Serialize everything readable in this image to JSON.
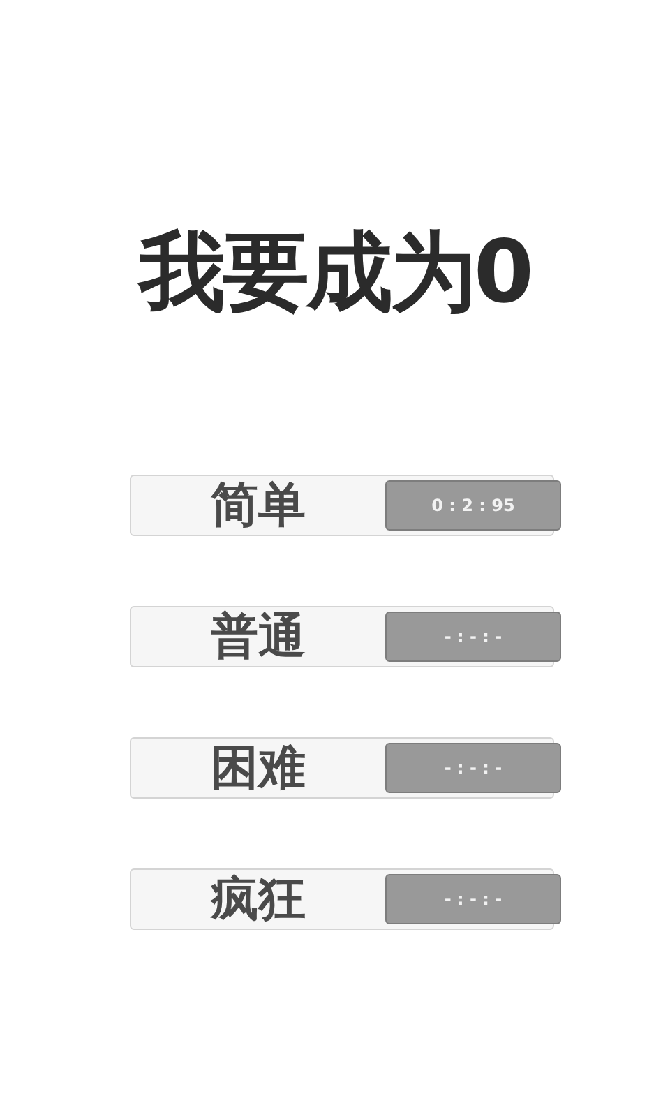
{
  "title": "我要成为0",
  "levels": [
    {
      "label": "简单",
      "best_time": "0 : 2 : 95"
    },
    {
      "label": "普通",
      "best_time": "- : - : -"
    },
    {
      "label": "困难",
      "best_time": "- : - : -"
    },
    {
      "label": "疯狂",
      "best_time": "- : - : -"
    }
  ]
}
